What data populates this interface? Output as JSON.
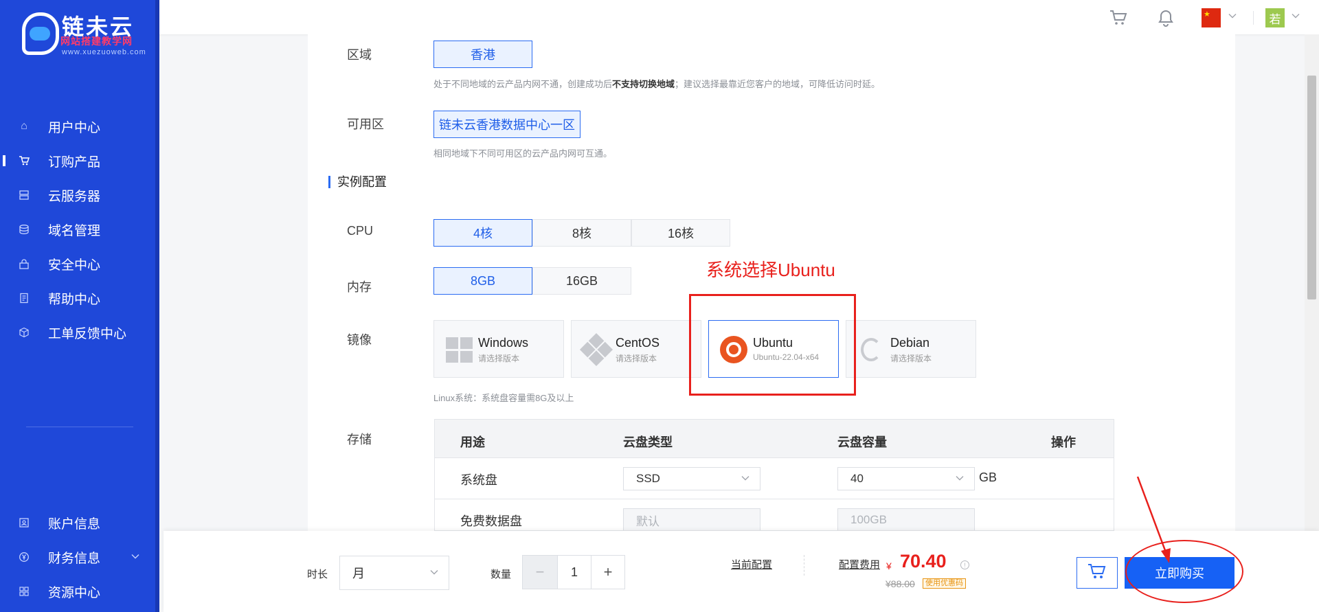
{
  "logo": {
    "name": "链未云",
    "subtitle": "网站搭建教学网",
    "url": "www.xuezuoweb.com"
  },
  "sidebar": {
    "items": [
      {
        "label": "用户中心",
        "icon": "home-icon"
      },
      {
        "label": "订购产品",
        "icon": "cart-icon",
        "active": true
      },
      {
        "label": "云服务器",
        "icon": "server-icon"
      },
      {
        "label": "域名管理",
        "icon": "database-icon"
      },
      {
        "label": "安全中心",
        "icon": "lock-icon"
      },
      {
        "label": "帮助中心",
        "icon": "document-icon"
      },
      {
        "label": "工单反馈中心",
        "icon": "cube-icon"
      }
    ],
    "bottom_items": [
      {
        "label": "账户信息",
        "icon": "user-card-icon"
      },
      {
        "label": "财务信息",
        "icon": "yen-icon",
        "expandable": true
      },
      {
        "label": "资源中心",
        "icon": "grid-icon"
      }
    ]
  },
  "header": {
    "flag": "CN",
    "avatar_text": "若"
  },
  "region": {
    "label": "区域",
    "selected": "香港",
    "hint_pre": "处于不同地域的云产品内网不通，创建成功后",
    "hint_bold": "不支持切换地域",
    "hint_post": "；建议选择最靠近您客户的地域，可降低访问时延。"
  },
  "zone": {
    "label": "可用区",
    "selected": "链未云香港数据中心一区",
    "hint": "相同地域下不同可用区的云产品内网可互通。"
  },
  "instance_section": "实例配置",
  "cpu": {
    "label": "CPU",
    "options": [
      "4核",
      "8核",
      "16核"
    ],
    "selected": "4核"
  },
  "memory": {
    "label": "内存",
    "options": [
      "8GB",
      "16GB"
    ],
    "selected": "8GB"
  },
  "image": {
    "label": "镜像",
    "options": [
      {
        "name": "Windows",
        "sub": "请选择版本",
        "icon": "windows-icon"
      },
      {
        "name": "CentOS",
        "sub": "请选择版本",
        "icon": "centos-icon"
      },
      {
        "name": "Ubuntu",
        "sub": "Ubuntu-22.04-x64",
        "icon": "ubuntu-icon",
        "selected": true
      },
      {
        "name": "Debian",
        "sub": "请选择版本",
        "icon": "debian-icon"
      }
    ],
    "hint": "Linux系统：系统盘容量需8G及以上"
  },
  "annotation": {
    "text": "系统选择Ubuntu",
    "color": "#e8201c"
  },
  "storage": {
    "label": "存储",
    "headers": [
      "用途",
      "云盘类型",
      "云盘容量",
      "操作"
    ],
    "rows": [
      {
        "usage": "系统盘",
        "type": "SSD",
        "capacity": "40",
        "unit": "GB"
      },
      {
        "usage": "免费数据盘",
        "type": "默认",
        "capacity": "100GB"
      }
    ]
  },
  "bottom": {
    "duration_label": "时长",
    "duration_value": "月",
    "quantity_label": "数量",
    "quantity_value": "1",
    "minus": "−",
    "plus": "+",
    "current_config": "当前配置",
    "fee_label": "配置费用",
    "currency": "¥",
    "price": "70.40",
    "original_price": "¥88.00",
    "discount_badge": "使用优惠码",
    "buy_label": "立即购买"
  },
  "colors": {
    "sidebar": "#1f48d9",
    "accent": "#1661f5",
    "annotation": "#e8201c",
    "price": "#e8201c"
  }
}
